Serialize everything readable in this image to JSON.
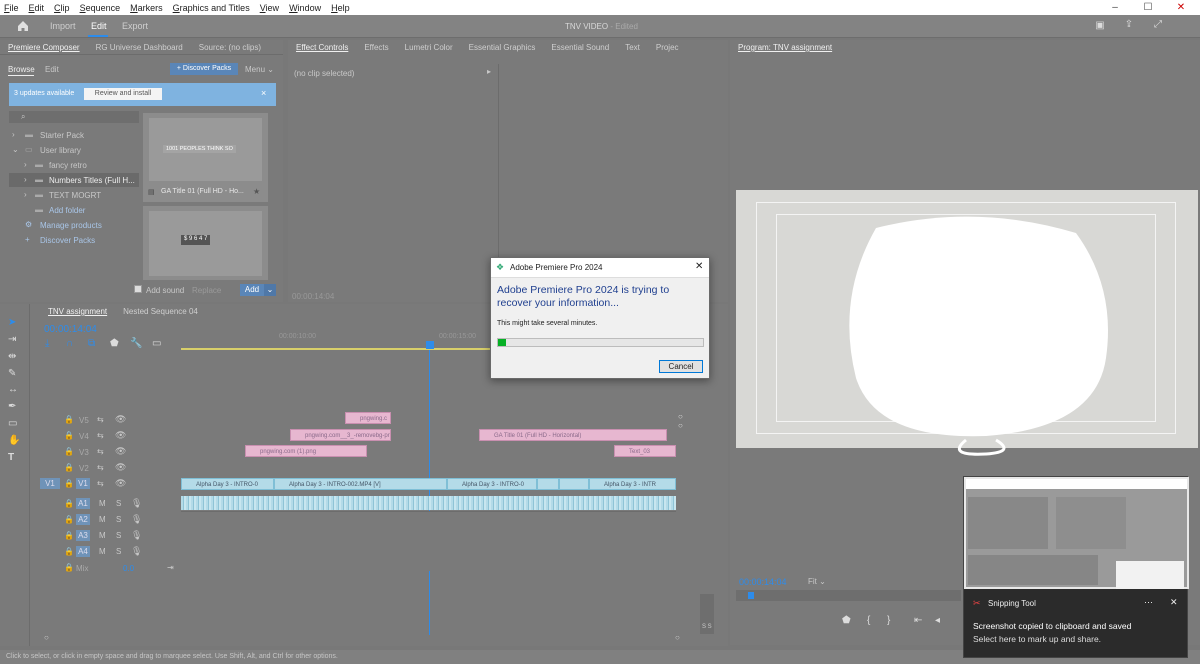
{
  "menu": {
    "items": [
      "File",
      "Edit",
      "Clip",
      "Sequence",
      "Markers",
      "Graphics and Titles",
      "View",
      "Window",
      "Help"
    ],
    "window_controls": [
      "–",
      "☐",
      "✕"
    ]
  },
  "topbar": {
    "tabs": [
      "Import",
      "Edit",
      "Export"
    ],
    "active_tab": "Edit",
    "title": "TNV VIDEO",
    "status": "- Edited"
  },
  "left_panel": {
    "tabs": [
      "Premiere Composer",
      "RG Universe Dashboard",
      "Source: (no clips)"
    ],
    "subtabs": [
      "Browse",
      "Edit"
    ],
    "discover_button": "+ Discover Packs",
    "menu_button": "Menu ⌄",
    "updates_text": "3 updates available",
    "review_button": "Review and install",
    "tree": [
      {
        "label": "Starter Pack"
      },
      {
        "label": "User library"
      },
      {
        "label": "fancy retro"
      },
      {
        "label": "Numbers Titles (Full H..."
      },
      {
        "label": "TEXT MOGRT"
      },
      {
        "label": "Add folder"
      },
      {
        "label": "Manage products"
      },
      {
        "label": "Discover Packs"
      }
    ],
    "thumb1_text": "1001 PEOPLES THINK SO",
    "thumb1_caption": "GA Title 01 (Full HD - Ho...",
    "thumb2_text": "$ 9 6 4 7",
    "add_sound": "Add sound",
    "replace": "Replace",
    "add": "Add"
  },
  "effect_panel": {
    "tabs": [
      "Effect Controls",
      "Effects",
      "Lumetri Color",
      "Essential Graphics",
      "Essential Sound",
      "Text",
      "Projec"
    ],
    "no_clip": "(no clip selected)",
    "timecode": "00:00:14:04"
  },
  "program": {
    "title": "Program: TNV assignment",
    "timecode": "00:00:14:04",
    "fit": "Fit"
  },
  "timeline": {
    "tabs": [
      "TNV assignment",
      "Nested Sequence 04"
    ],
    "timecode": "00:00:14:04",
    "ruler": [
      "00:00:10:00",
      "00:00:15:00"
    ],
    "video_tracks": [
      "V5",
      "V4",
      "V3",
      "V2",
      "V1"
    ],
    "audio_tracks": [
      "A1",
      "A2",
      "A3",
      "A4"
    ],
    "mix_label": "Mix",
    "mix_value": "0.0",
    "source_patch": "V1",
    "clips": {
      "v5": "pngwing.c",
      "v4a": "pngwing.com__3_-removebg-pr",
      "v4b": "GA Title 01 (Full HD - Horizontal)",
      "v3a": "pngwing.com (1).png",
      "v3b": "Text_03",
      "v1a": "Alpha Day 3 - INTRO-0",
      "v1b": "Alpha Day 3 - INTRO-002.MP4 [V]",
      "v1c": "Alpha Day 3 - INTRO-0",
      "v1d": "Alpha Day 3 - INTR"
    }
  },
  "dialog": {
    "title": "Adobe Premiere Pro 2024",
    "heading": "Adobe Premiere Pro 2024 is trying to recover your information...",
    "message": "This might take several minutes.",
    "progress": 0.04,
    "cancel": "Cancel"
  },
  "toast": {
    "app": "Snipping Tool",
    "title": "Screenshot copied to clipboard and saved",
    "body": "Select here to mark up and share."
  },
  "status_bar": "Click to select, or click in empty space and drag to marquee select. Use Shift, Alt, and Ctrl for other options.",
  "colors": {
    "accent": "#2d8ceb",
    "clip_pink": "#e7b7d0",
    "clip_blue": "#b4dbe8",
    "dialog_heading": "#1f3f8f",
    "progress": "#06b025"
  }
}
